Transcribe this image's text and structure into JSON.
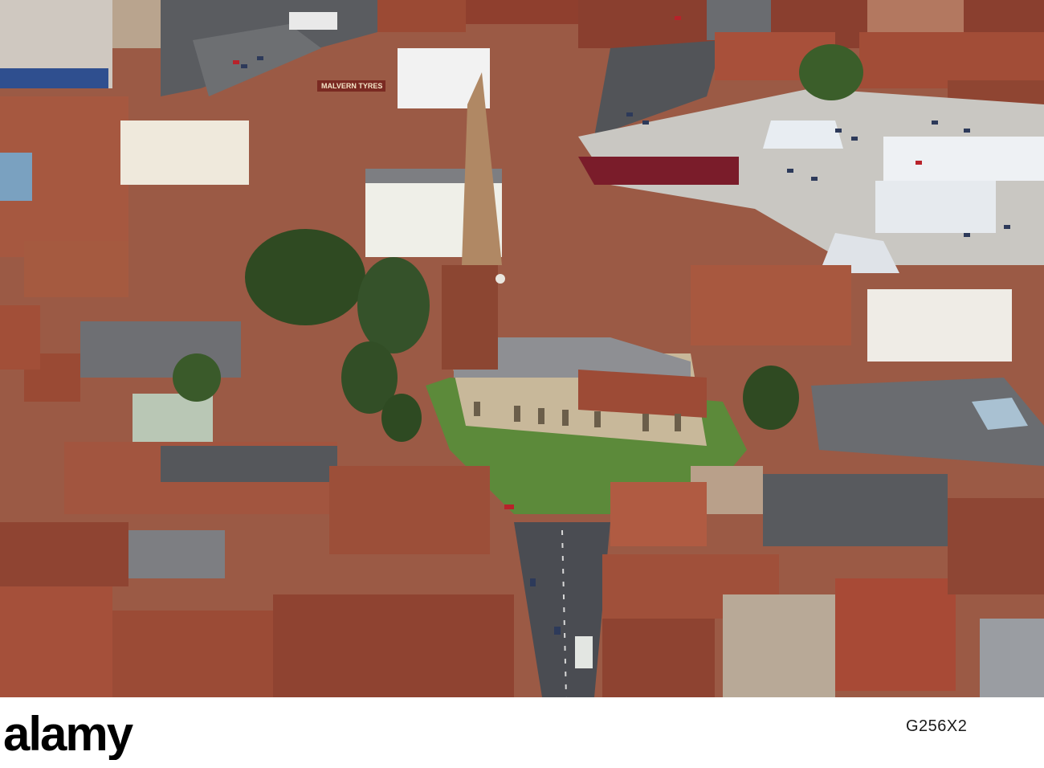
{
  "photo": {
    "subject": "aerial-town-centre",
    "colors": {
      "roof_red": "#a9523a",
      "roof_dark": "#7f3b2a",
      "grass": "#5c8a3a",
      "tree": "#2f4a22",
      "road": "#4a4c52",
      "car_park": "#c9c7c2",
      "stone": "#c8b89a",
      "slate": "#6f7074"
    },
    "signs": {
      "shop_sign": "MALVERN TYRES"
    }
  },
  "footer": {
    "logo_text": "alamy",
    "image_id": "G256X2"
  }
}
